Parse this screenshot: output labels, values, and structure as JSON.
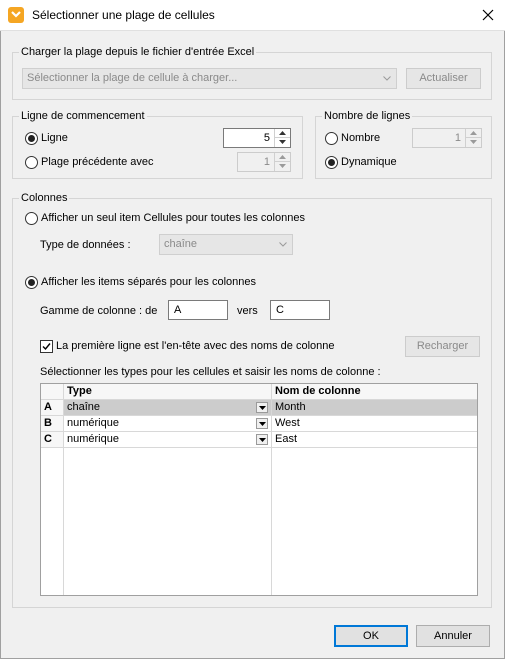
{
  "window": {
    "title": "Sélectionner une plage de cellules"
  },
  "load_section": {
    "title": "Charger la plage depuis le fichier d'entrée Excel",
    "combo_value": "Sélectionner la plage de cellule à charger...",
    "refresh_label": "Actualiser"
  },
  "start_row": {
    "title": "Ligne de commencement",
    "row_label": "Ligne",
    "row_value": "5",
    "previous_range_label": "Plage précédente avec",
    "previous_range_value": "1"
  },
  "row_count": {
    "title": "Nombre de lignes",
    "number_label": "Nombre",
    "number_value": "1",
    "dynamic_label": "Dynamique"
  },
  "columns": {
    "title": "Colonnes",
    "single_item_label": "Afficher un seul item Cellules pour toutes les colonnes",
    "data_type_label": "Type de données :",
    "data_type_value": "chaîne",
    "separate_items_label": "Afficher les items séparés pour les colonnes",
    "range_label": "Gamme de colonne : de",
    "range_from": "A",
    "range_to_label": "vers",
    "range_to": "C",
    "header_checkbox_label": "La première ligne est l'en-tête avec des noms de colonne",
    "reload_label": "Recharger",
    "grid_caption": "Sélectionner les types pour les cellules et saisir les noms de colonne :",
    "grid": {
      "headers": [
        "",
        "Type",
        "Nom de colonne"
      ],
      "rows": [
        {
          "col": "A",
          "type": "chaîne",
          "name": "Month"
        },
        {
          "col": "B",
          "type": "numérique",
          "name": "West"
        },
        {
          "col": "C",
          "type": "numérique",
          "name": "East"
        }
      ]
    }
  },
  "footer": {
    "ok_label": "OK",
    "cancel_label": "Annuler"
  },
  "colors": {
    "accent": "#0078d7",
    "app_icon": "#f5a623"
  }
}
